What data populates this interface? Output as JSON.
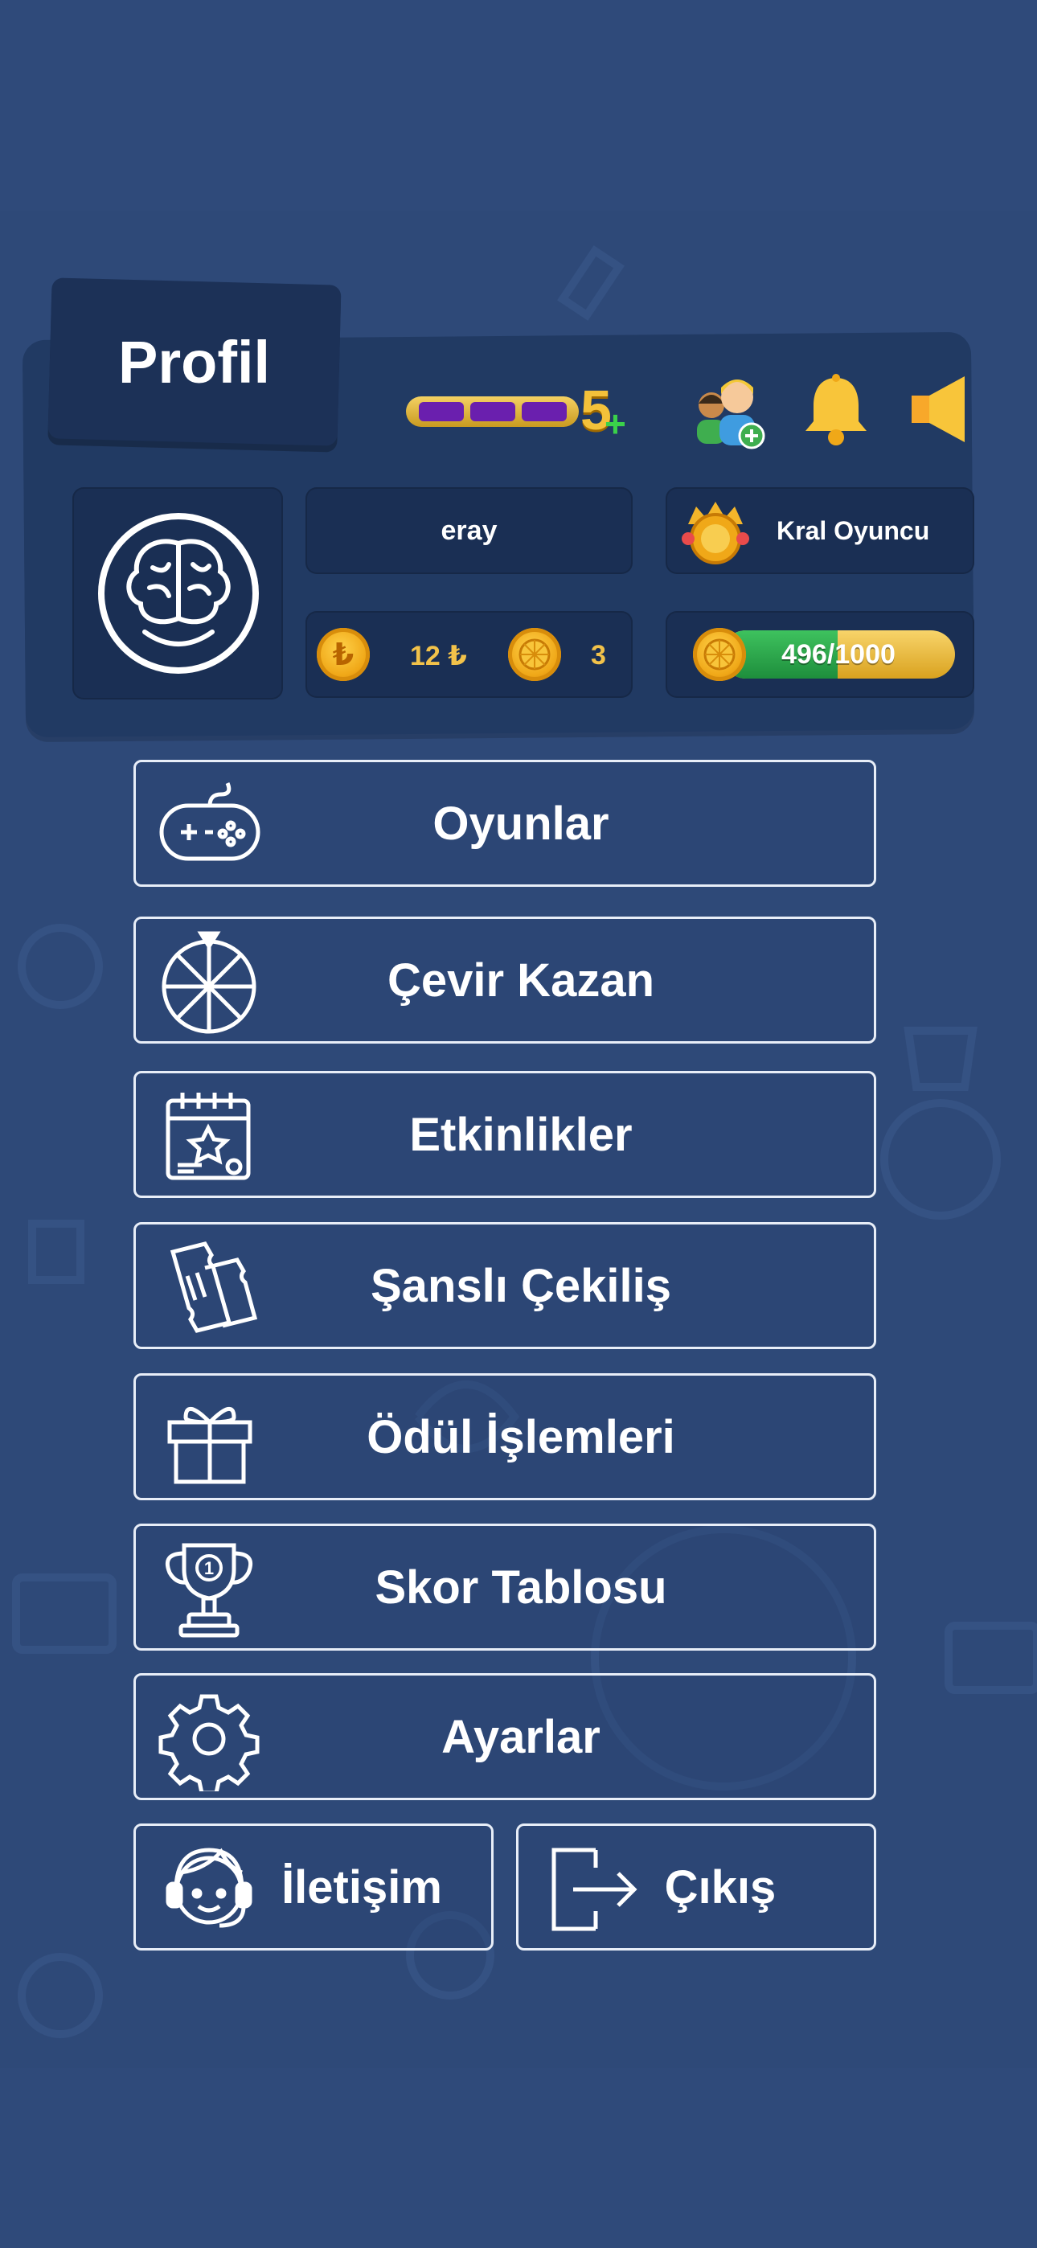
{
  "header": {
    "title": "Profil"
  },
  "level": {
    "value": "5",
    "plus": "+",
    "segments": 3
  },
  "user": {
    "name": "eray",
    "rank_title": "Kral Oyuncu"
  },
  "currency": {
    "lira_amount": "12 ₺",
    "lira_symbol": "₺",
    "token_amount": "3"
  },
  "xp": {
    "text": "496/1000",
    "current": 496,
    "max": 1000
  },
  "icons": [
    "brain-icon",
    "friends-add-icon",
    "bell-icon",
    "sound-icon",
    "crown-badge-icon",
    "lira-coin-icon",
    "orange-token-icon"
  ],
  "menu": {
    "games": "Oyunlar",
    "spin_win": "Çevir Kazan",
    "events": "Etkinlikler",
    "lucky_draw": "Şanslı Çekiliş",
    "rewards": "Ödül İşlemleri",
    "leaderboard": "Skor Tablosu",
    "settings": "Ayarlar",
    "contact": "İletişim",
    "logout": "Çıkış"
  },
  "colors": {
    "background": "#2f4a7a",
    "panel": "#213a63",
    "box": "#1a2f54",
    "accent_gold": "#f3c13a",
    "xp_green": "#2fa84e"
  }
}
